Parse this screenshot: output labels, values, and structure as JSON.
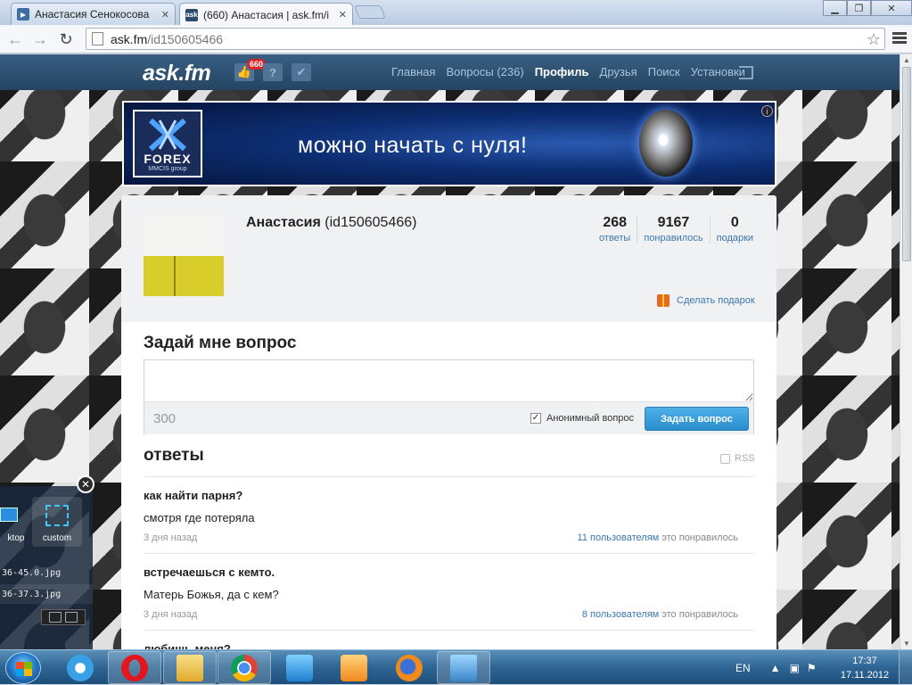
{
  "browser": {
    "tabs": [
      {
        "title": "Анастасия Сенокосова",
        "close": "✕"
      },
      {
        "title": "(660) Анастасия | ask.fm/i",
        "close": "✕"
      }
    ],
    "url_host": "ask.fm",
    "url_path": "/id150605466"
  },
  "site": {
    "logo": "ask.fm",
    "notification_count": "660",
    "nav": [
      "Главная",
      "Вопросы (236)",
      "Профиль",
      "Друзья",
      "Поиск",
      "Установки"
    ],
    "active_nav": "Профиль"
  },
  "banner": {
    "brand": "FOREX",
    "brand_sub": "MMCIS group",
    "text": "можно  начать с нуля!",
    "info": "i"
  },
  "profile": {
    "name": "Анастасия",
    "username": "(id150605466)",
    "stats": [
      {
        "value": "268",
        "label": "ответы"
      },
      {
        "value": "9167",
        "label": "понравилось"
      },
      {
        "value": "0",
        "label": "подарки"
      }
    ],
    "gift_link": "Сделать подарок"
  },
  "ask": {
    "title": "Задай мне вопрос",
    "counter": "300",
    "anon_label": "Анонимный вопрос",
    "anon_checked": true,
    "button": "Задать вопрос"
  },
  "answers": {
    "title": "ответы",
    "rss": "RSS",
    "items": [
      {
        "question": "как найти парня?",
        "answer": "смотря где потеряла",
        "time": "3 дня назад",
        "likes_users": "11 пользователям",
        "likes_suffix": " это понравилось"
      },
      {
        "question": "встречаешься с кемто.",
        "answer": "Матерь Божья, да с кем?",
        "time": "3 дня назад",
        "likes_users": "8 пользователям",
        "likes_suffix": " это понравилось"
      },
      {
        "question": "любишь меня?",
        "answer": "",
        "time": "",
        "likes_users": "",
        "likes_suffix": ""
      }
    ]
  },
  "capture_widget": {
    "close": "✕",
    "tiles": [
      "ktop",
      "custom"
    ],
    "files": [
      "36-45.0.jpg",
      "36-37.3.jpg"
    ]
  },
  "taskbar": {
    "lang": "EN",
    "time": "17:37",
    "date": "17.11.2012"
  }
}
